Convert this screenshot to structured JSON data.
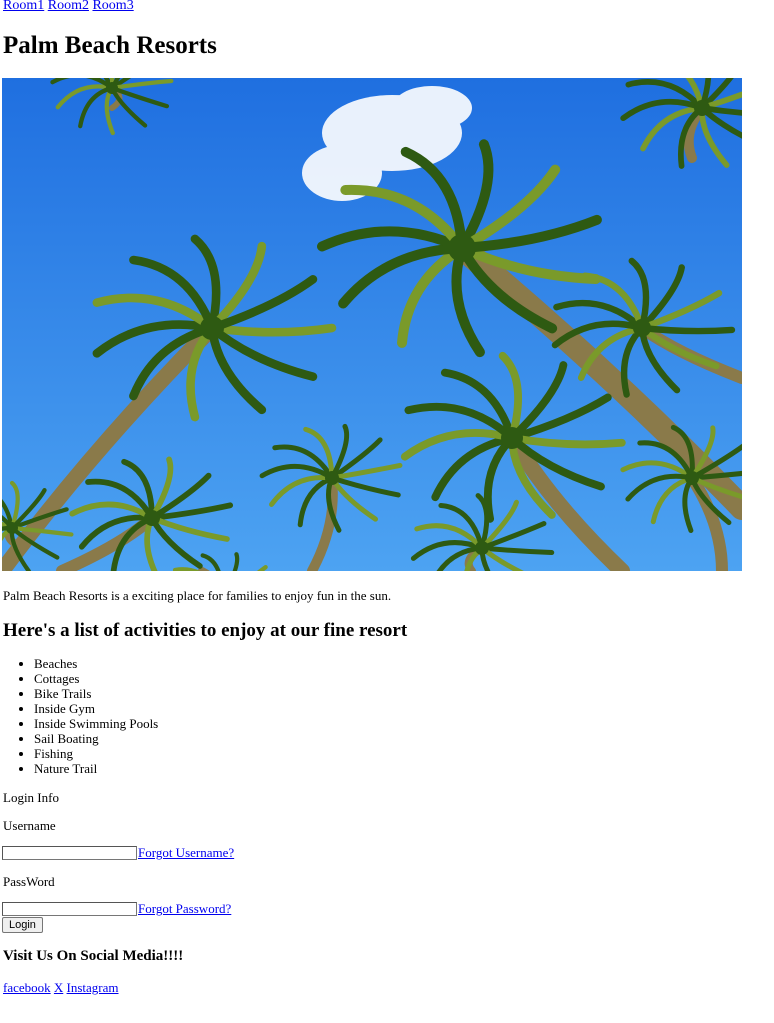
{
  "nav": {
    "links": [
      "Room1",
      "Room2",
      "Room3"
    ]
  },
  "header": {
    "title": "Palm Beach Resorts"
  },
  "hero": {
    "alt": "Palm trees against a blue sky",
    "colors": {
      "sky_top": "#1f6fe0",
      "sky_bottom": "#4da3f2",
      "frond": "#2e5a12",
      "frond_light": "#7a9a2a",
      "trunk": "#8a7a4a",
      "cloud": "#ffffff"
    }
  },
  "intro": {
    "text": "Palm Beach Resorts is a exciting place for families to enjoy fun in the sun."
  },
  "activities": {
    "heading": "Here's a list of activities to enjoy at our fine resort",
    "items": [
      "Beaches",
      "Cottages",
      "Bike Trails",
      "Inside Gym",
      "Inside Swimming Pools",
      "Sail Boating",
      "Fishing",
      "Nature Trail"
    ]
  },
  "login": {
    "section_label": "Login Info",
    "username_label": "Username",
    "username_value": "",
    "forgot_username": "Forgot Username?",
    "password_label": "PassWord",
    "password_value": "",
    "forgot_password": "Forgot Password?",
    "button_label": "Login"
  },
  "social": {
    "heading": "Visit Us On Social Media!!!!",
    "links": [
      "facebook",
      "X",
      "Instagram"
    ]
  }
}
